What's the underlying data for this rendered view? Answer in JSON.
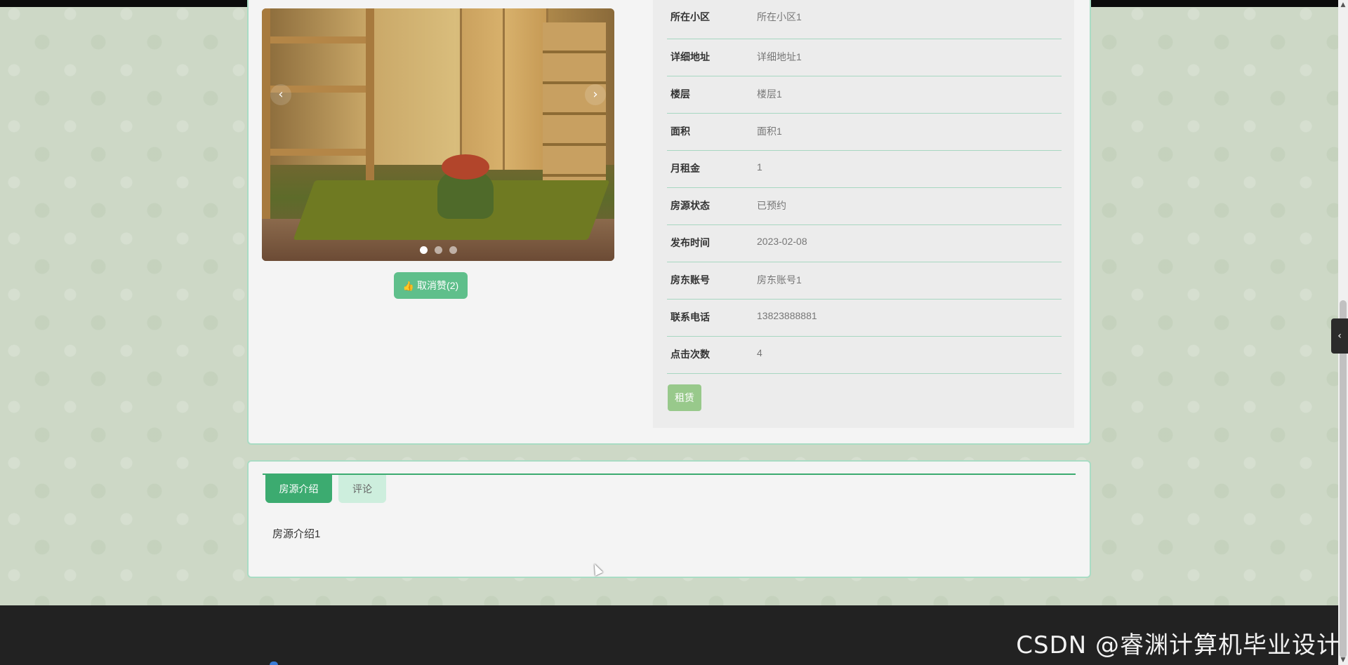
{
  "carousel": {
    "prev_icon": "‹",
    "next_icon": "›",
    "slide_count": 3,
    "active_slide": 1
  },
  "like_button": {
    "icon": "thumbs-up-icon",
    "label": "取消赞(2)"
  },
  "details": [
    {
      "label": "所在小区",
      "value": "所在小区1"
    },
    {
      "label": "详细地址",
      "value": "详细地址1"
    },
    {
      "label": "楼层",
      "value": "楼层1"
    },
    {
      "label": "面积",
      "value": "面积1"
    },
    {
      "label": "月租金",
      "value": "1"
    },
    {
      "label": "房源状态",
      "value": "已预约"
    },
    {
      "label": "发布时间",
      "value": "2023-02-08"
    },
    {
      "label": "房东账号",
      "value": "房东账号1"
    },
    {
      "label": "联系电话",
      "value": "13823888881"
    },
    {
      "label": "点击次数",
      "value": "4"
    }
  ],
  "rent_button": {
    "label": "租赁"
  },
  "tabs": [
    {
      "label": "房源介绍",
      "active": true
    },
    {
      "label": "评论",
      "active": false
    }
  ],
  "tab_content": "房源介绍1",
  "side_toggle": {
    "icon": "‹"
  },
  "watermark": "CSDN @睿渊计算机毕业设计",
  "colors": {
    "accent": "#3cab70",
    "like_button": "#5fbf8b",
    "rent_button": "#98c98b",
    "footer": "#222222"
  }
}
